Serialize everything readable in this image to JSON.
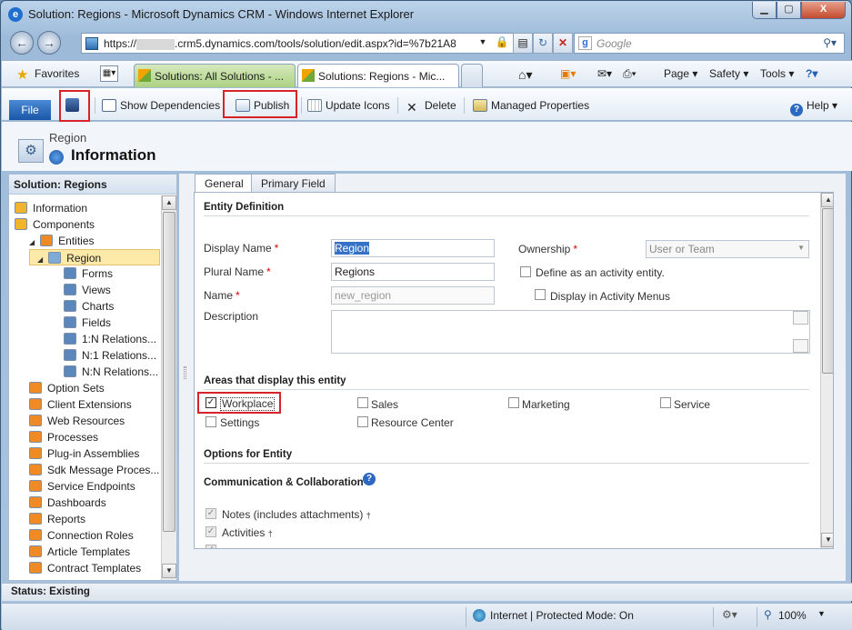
{
  "window": {
    "title": "Solution: Regions - Microsoft Dynamics CRM - Windows Internet Explorer",
    "min": "▁",
    "max": "▢",
    "close": "X"
  },
  "address": {
    "url_prefix": "https://",
    "url_suffix": ".crm5.dynamics.com/tools/solution/edit.aspx?id=%7b21A8",
    "search_placeholder": "Google"
  },
  "favorites": {
    "label": "Favorites",
    "tabs": [
      {
        "label": "Solutions: All Solutions - ..."
      },
      {
        "label": "Solutions: Regions - Mic..."
      }
    ],
    "commands": {
      "page": "Page ▾",
      "safety": "Safety ▾",
      "tools": "Tools ▾",
      "help": "?▾"
    }
  },
  "ribbon": {
    "file": "File",
    "show_dependencies": "Show Dependencies",
    "publish": "Publish",
    "update_icons": "Update Icons",
    "delete": "Delete",
    "managed_properties": "Managed Properties",
    "help": "Help ▾"
  },
  "header": {
    "entity": "Region",
    "form": "Information"
  },
  "nav": {
    "title": "Solution: Regions",
    "items": [
      {
        "label": "Information",
        "level": 0
      },
      {
        "label": "Components",
        "level": 0
      },
      {
        "label": "Entities",
        "level": 1,
        "toggle": "◢"
      },
      {
        "label": "Region",
        "level": 2,
        "toggle": "◢"
      },
      {
        "label": "Forms",
        "level": 3
      },
      {
        "label": "Views",
        "level": 3
      },
      {
        "label": "Charts",
        "level": 3
      },
      {
        "label": "Fields",
        "level": 3
      },
      {
        "label": "1:N Relations...",
        "level": 3
      },
      {
        "label": "N:1 Relations...",
        "level": 3
      },
      {
        "label": "N:N Relations...",
        "level": 3
      },
      {
        "label": "Option Sets",
        "level": 1
      },
      {
        "label": "Client Extensions",
        "level": 1
      },
      {
        "label": "Web Resources",
        "level": 1
      },
      {
        "label": "Processes",
        "level": 1
      },
      {
        "label": "Plug-in Assemblies",
        "level": 1
      },
      {
        "label": "Sdk Message Proces...",
        "level": 1
      },
      {
        "label": "Service Endpoints",
        "level": 1
      },
      {
        "label": "Dashboards",
        "level": 1
      },
      {
        "label": "Reports",
        "level": 1
      },
      {
        "label": "Connection Roles",
        "level": 1
      },
      {
        "label": "Article Templates",
        "level": 1
      },
      {
        "label": "Contract Templates",
        "level": 1
      }
    ]
  },
  "form": {
    "tabs": [
      "General",
      "Primary Field"
    ],
    "entity_definition": "Entity Definition",
    "display_name_label": "Display Name",
    "display_name_value": "Region",
    "plural_name_label": "Plural Name",
    "plural_name_value": "Regions",
    "name_label": "Name",
    "name_value": "new_region",
    "description_label": "Description",
    "ownership_label": "Ownership",
    "ownership_value": "User or Team",
    "activity_entity_label": "Define as an activity entity.",
    "activity_menus_label": "Display in Activity Menus",
    "required_mark": "*",
    "areas_title": "Areas that display this entity",
    "areas": {
      "workplace": "Workplace",
      "sales": "Sales",
      "marketing": "Marketing",
      "service": "Service",
      "settings": "Settings",
      "resource_center": "Resource Center"
    },
    "options_title": "Options for Entity",
    "comm_title": "Communication & Collaboration",
    "notes": "Notes (includes attachments)",
    "activities": "Activities",
    "dagger": "†",
    "checkmark": "✓"
  },
  "status": {
    "text": "Status: Existing"
  },
  "ie_status": {
    "zone": "Internet | Protected Mode: On",
    "zoom": "100%"
  }
}
